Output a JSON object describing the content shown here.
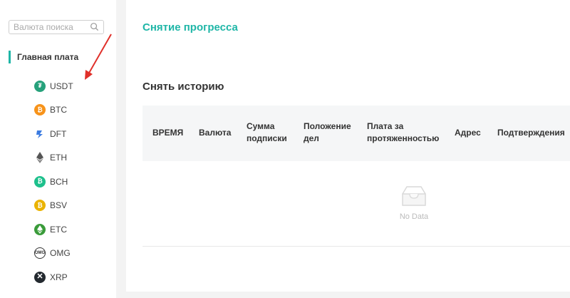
{
  "sidebar": {
    "search": {
      "placeholder": "Валюта поиска",
      "icon": "search-icon"
    },
    "section_title": "Главная плата",
    "accent_color": "#1fb6a7",
    "coins": [
      {
        "label": "USDT",
        "icon": "tether-icon",
        "color": "#26a17b"
      },
      {
        "label": "BTC",
        "icon": "bitcoin-icon",
        "color": "#f7931a"
      },
      {
        "label": "DFT",
        "icon": "dft-icon",
        "color": "#3b7be0"
      },
      {
        "label": "ETH",
        "icon": "ethereum-icon",
        "color": "#555555"
      },
      {
        "label": "BCH",
        "icon": "bitcoin-cash-icon",
        "color": "#1dc08c"
      },
      {
        "label": "BSV",
        "icon": "bitcoin-sv-icon",
        "color": "#eab300"
      },
      {
        "label": "ETC",
        "icon": "ethereum-classic-icon",
        "color": "#3a9b3a"
      },
      {
        "label": "OMG",
        "icon": "omg-icon",
        "color": "#ffffff"
      },
      {
        "label": "XRP",
        "icon": "xrp-icon",
        "color": "#23292f"
      }
    ]
  },
  "main": {
    "title": "Снятие прогресса",
    "history_title": "Снять историю",
    "columns": [
      "ВРЕМЯ",
      "Валюта",
      "Сумма подписки",
      "Положение дел",
      "Плата за протяженностью",
      "Адрес",
      "Подтверждения"
    ],
    "empty_text": "No Data"
  }
}
